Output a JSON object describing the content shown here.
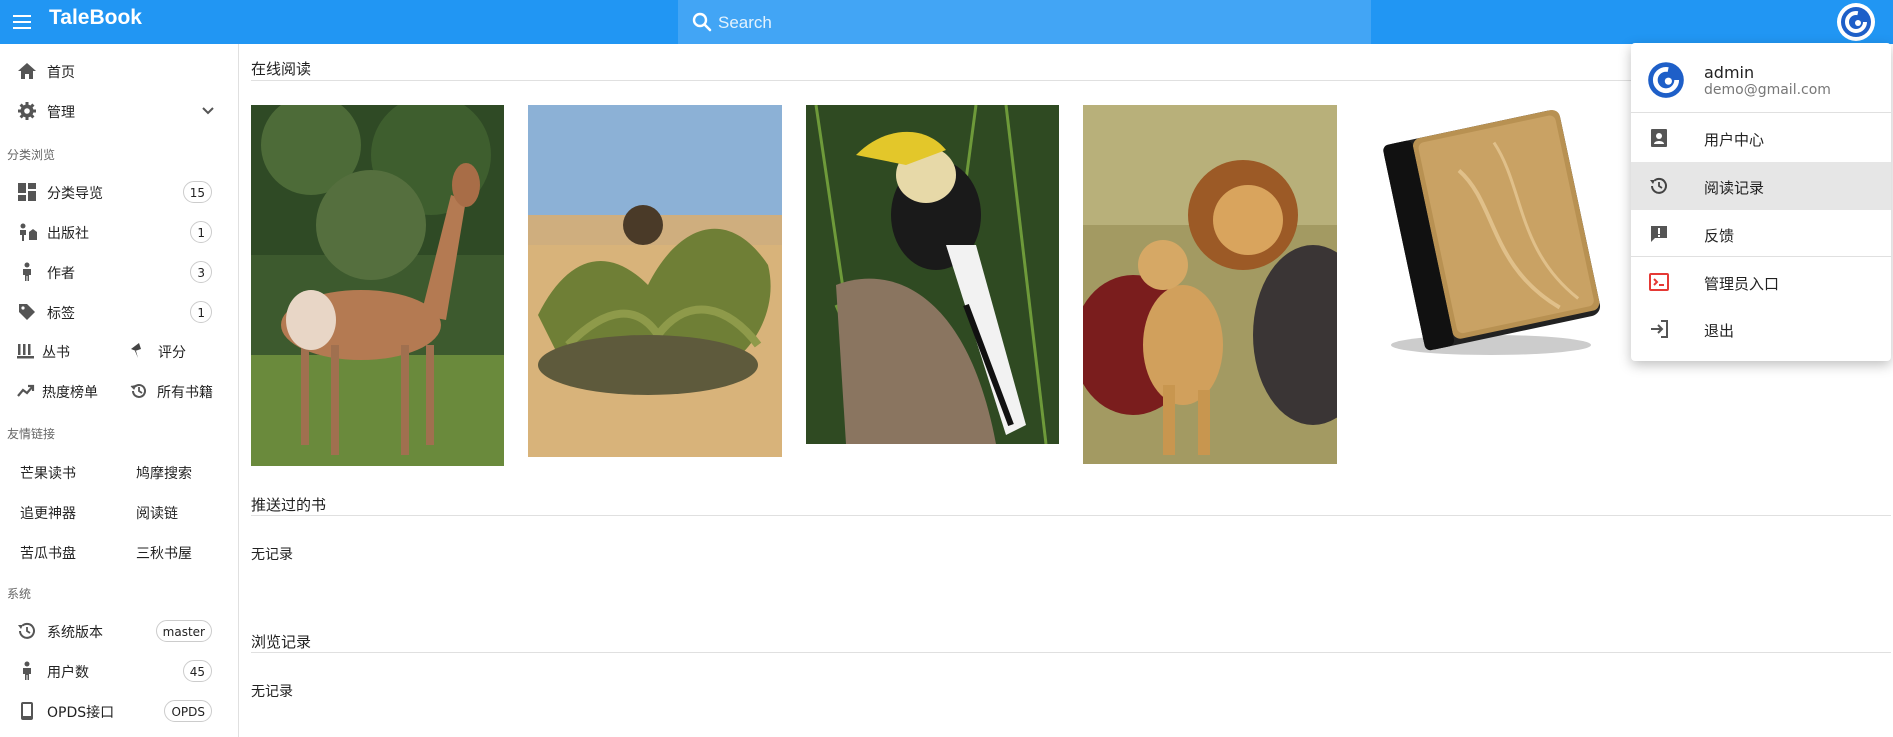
{
  "app": {
    "title": "TaleBook"
  },
  "search": {
    "placeholder": "Search"
  },
  "sidebar": {
    "home": "首页",
    "admin": "管理",
    "section_browse": "分类浏览",
    "items": [
      {
        "label": "分类导览",
        "count": "15"
      },
      {
        "label": "出版社",
        "count": "1"
      },
      {
        "label": "作者",
        "count": "3"
      },
      {
        "label": "标签",
        "count": "1"
      }
    ],
    "series": "丛书",
    "rating": "评分",
    "hot": "热度榜单",
    "all_books": "所有书籍",
    "section_links": "友情链接",
    "links": [
      "芒果读书",
      "鸠摩搜索",
      "追更神器",
      "阅读链",
      "苦瓜书盘",
      "三秋书屋"
    ],
    "section_system": "系统",
    "system": [
      {
        "label": "系统版本",
        "badge": "master"
      },
      {
        "label": "用户数",
        "badge": "45"
      },
      {
        "label": "OPDS接口",
        "badge": "OPDS"
      }
    ]
  },
  "main": {
    "online_reading": "在线阅读",
    "pushed_books": "推送过的书",
    "pushed_empty": "无记录",
    "history": "浏览记录",
    "history_empty": "无记录"
  },
  "user_menu": {
    "name": "admin",
    "email": "demo@gmail.com",
    "items": [
      "用户中心",
      "阅读记录",
      "反馈",
      "管理员入口",
      "退出"
    ]
  },
  "colors": {
    "primary": "#2196f3",
    "admin_red": "#e53935",
    "avatar_blue": "#1e5fc8"
  }
}
